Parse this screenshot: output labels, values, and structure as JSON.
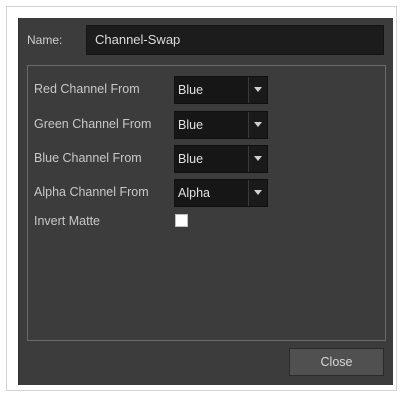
{
  "dialog": {
    "name_label": "Name:",
    "name_value": "Channel-Swap",
    "rows": [
      {
        "label": "Red Channel From",
        "value": "Blue"
      },
      {
        "label": "Green Channel From",
        "value": "Blue"
      },
      {
        "label": "Blue Channel From",
        "value": "Blue"
      },
      {
        "label": "Alpha Channel From",
        "value": "Alpha"
      }
    ],
    "invert_matte_label": "Invert Matte",
    "invert_matte_checked": false,
    "close_label": "Close"
  },
  "colors": {
    "dialog_bg": "#3c3c3c",
    "field_bg": "#1c1c1c",
    "button_bg": "#505050",
    "text": "#c8c8c8"
  },
  "icons": {
    "dropdown_arrow": "chevron-down-icon"
  }
}
